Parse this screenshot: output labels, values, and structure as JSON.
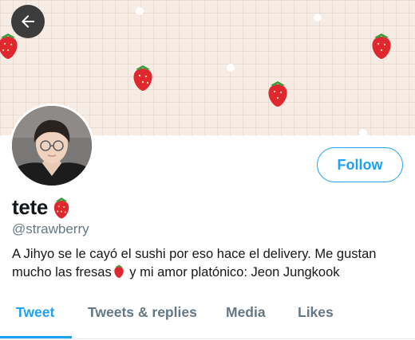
{
  "header": {
    "back_icon": "arrow-left-icon"
  },
  "profile": {
    "display_name": "tete",
    "name_emoji": "strawberry-icon",
    "handle": "@strawberry",
    "bio_part1": "A Jihyo se le cayó el sushi por eso hace el delivery. Me gustan mucho las fresas",
    "bio_part2": " y mi amor platónico: Jeon Jungkook",
    "follow_label": "Follow"
  },
  "tabs": [
    {
      "label": "Tweet",
      "active": true
    },
    {
      "label": "Tweets & replies",
      "active": false
    },
    {
      "label": "Media",
      "active": false
    },
    {
      "label": "Likes",
      "active": false
    }
  ],
  "colors": {
    "accent": "#1da1f2",
    "secondary_text": "#657786",
    "banner_bg": "#f6ece4",
    "strawberry": "#e0262f"
  }
}
